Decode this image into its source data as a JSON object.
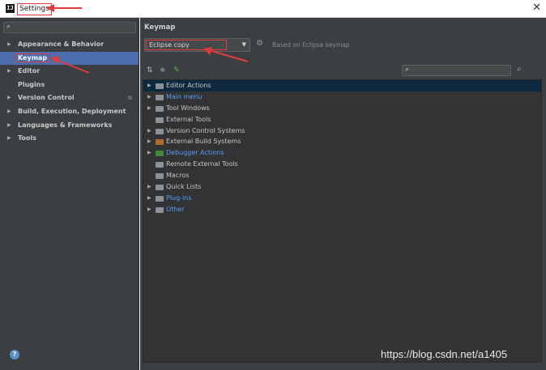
{
  "window": {
    "title": "Settings",
    "app_icon": "IJ",
    "close_glyph": "✕"
  },
  "sidebar": {
    "search_placeholder": "",
    "items": [
      {
        "label": "Appearance & Behavior",
        "expandable": true
      },
      {
        "label": "Keymap",
        "expandable": false,
        "selected": true
      },
      {
        "label": "Editor",
        "expandable": true
      },
      {
        "label": "Plugins",
        "expandable": false
      },
      {
        "label": "Version Control",
        "expandable": true,
        "badge": "⧉"
      },
      {
        "label": "Build, Execution, Deployment",
        "expandable": true
      },
      {
        "label": "Languages & Frameworks",
        "expandable": true
      },
      {
        "label": "Tools",
        "expandable": true
      }
    ],
    "help_label": "?"
  },
  "keymap": {
    "heading": "Keymap",
    "selected_keymap": "Eclipse copy",
    "based_on": "Based on Eclipse keymap",
    "search_placeholder": "",
    "actions": [
      {
        "label": "Editor Actions",
        "expandable": true,
        "link": false,
        "icon": "folder"
      },
      {
        "label": "Main menu",
        "expandable": true,
        "link": true,
        "icon": "folder"
      },
      {
        "label": "Tool Windows",
        "expandable": true,
        "link": false,
        "icon": "folder"
      },
      {
        "label": "External Tools",
        "expandable": false,
        "link": false,
        "icon": "folder"
      },
      {
        "label": "Version Control Systems",
        "expandable": true,
        "link": false,
        "icon": "folder"
      },
      {
        "label": "External Build Systems",
        "expandable": true,
        "link": false,
        "icon": "build-folder"
      },
      {
        "label": "Debugger Actions",
        "expandable": true,
        "link": true,
        "icon": "debugger-folder"
      },
      {
        "label": "Remote External Tools",
        "expandable": false,
        "link": false,
        "icon": "folder"
      },
      {
        "label": "Macros",
        "expandable": false,
        "link": false,
        "icon": "folder"
      },
      {
        "label": "Quick Lists",
        "expandable": true,
        "link": false,
        "icon": "folder"
      },
      {
        "label": "Plug-ins",
        "expandable": true,
        "link": true,
        "icon": "folder"
      },
      {
        "label": "Other",
        "expandable": true,
        "link": true,
        "icon": "folder"
      }
    ]
  },
  "watermark": "https://blog.csdn.net/a1405",
  "colors": {
    "panel_bg": "#3c3f41",
    "selection": "#4b6eaf",
    "link": "#589df6",
    "annotation_red": "#e23b3b"
  }
}
